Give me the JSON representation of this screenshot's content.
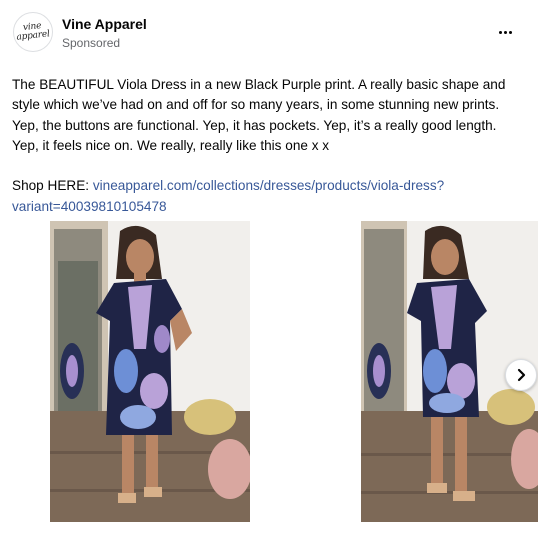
{
  "post": {
    "page_name": "Vine Apparel",
    "sponsored_label": "Sponsored",
    "avatar_logo": [
      "vine",
      "apparel"
    ],
    "body_lines": [
      "The BEAUTIFUL Viola Dress in a new Black Purple print. A really basic shape and style which we’ve had on and off for so many years, in some stunning new prints. Yep, the buttons are functional. Yep, it has pockets. Yep, it’s a really good length. Yep, it feels nice on. We really, really like this one x x"
    ],
    "shop_prefix": "Shop HERE: ",
    "shop_link": "vineapparel.com/collections/dresses/products/viola-dress?variant=40039810105478"
  },
  "icons": {
    "more": "more-horizontal-icon",
    "next": "chevron-right-icon"
  },
  "colors": {
    "link": "#385898",
    "secondary_text": "#65676b",
    "dress_navy": "#1f2446",
    "dress_lilac": "#b9a2d8",
    "dress_blue": "#6d8fd6",
    "floor": "#7d6957",
    "wall": "#f1efec"
  }
}
